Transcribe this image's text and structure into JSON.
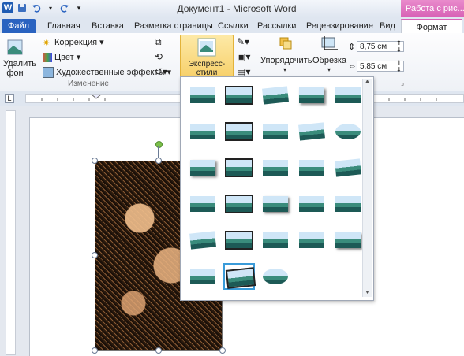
{
  "window": {
    "title": "Документ1 - Microsoft Word",
    "context_header": "Работа с рис..."
  },
  "qat": {
    "word_logo": "W",
    "save_icon": "save-icon",
    "undo_icon": "undo-icon",
    "redo_icon": "redo-icon"
  },
  "tabs": [
    {
      "label": "Файл"
    },
    {
      "label": "Главная"
    },
    {
      "label": "Вставка"
    },
    {
      "label": "Разметка страницы"
    },
    {
      "label": "Ссылки"
    },
    {
      "label": "Рассылки"
    },
    {
      "label": "Рецензирование"
    },
    {
      "label": "Вид"
    },
    {
      "label": "Формат"
    }
  ],
  "ribbon": {
    "remove_bg_line1": "Удалить",
    "remove_bg_line2": "фон",
    "correction": "Коррекция",
    "color": "Цвет",
    "artistic": "Художественные эффекты",
    "group_change": "Изменение",
    "express_styles": "Экспресс-стили",
    "arrange": "Упорядочить",
    "crop": "Обрезка",
    "height": "8,75 см",
    "width": "5,85 см"
  },
  "ruler": {
    "corner": "L"
  },
  "gallery": {
    "rows": 6,
    "cols": 5,
    "last_row_count": 3,
    "selected_index": 26
  },
  "colors": {
    "accent": "#2a63c0",
    "context_tab": "#d761b5",
    "selection": "#3a9bd9"
  }
}
